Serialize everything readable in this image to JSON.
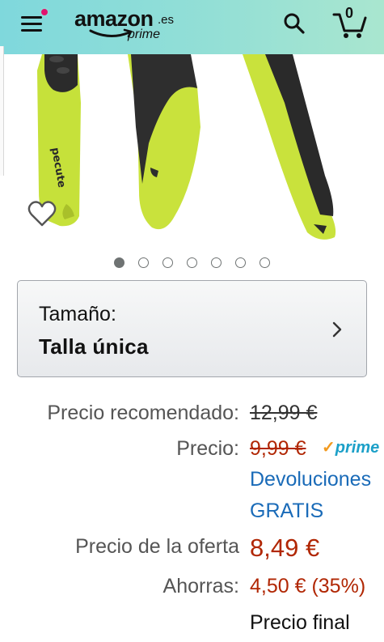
{
  "header": {
    "logo_word": "amazon",
    "logo_suffix": ".es",
    "logo_sub": "prime",
    "cart_count": "0",
    "menu_icon": "hamburger-icon",
    "search_icon": "search-icon",
    "cart_icon": "cart-icon",
    "notification_color": "#e2136e",
    "header_gradient": [
      "#7fd8dc",
      "#a9e6cf"
    ]
  },
  "product_image": {
    "brand_mark": "pecute",
    "accent_color": "#c7e03a",
    "wishlist_icon": "heart-outline-icon"
  },
  "carousel": {
    "count": 7,
    "active_index": 0
  },
  "size_selector": {
    "label": "Tamaño:",
    "value": "Talla única",
    "icon": "chevron-right-icon"
  },
  "pricing": {
    "recommended_label": "Precio recomendado:",
    "recommended_value": "12,99 €",
    "price_label": "Precio:",
    "price_value": "9,99 €",
    "prime_badge": "prime",
    "returns_line1": "Devoluciones",
    "returns_line2": "GRATIS",
    "deal_label": "Precio de la oferta",
    "deal_value": "8,49 €",
    "savings_label": "Ahorras:",
    "savings_value": "4,50 € (35%)",
    "final_price_text": "Precio final"
  }
}
